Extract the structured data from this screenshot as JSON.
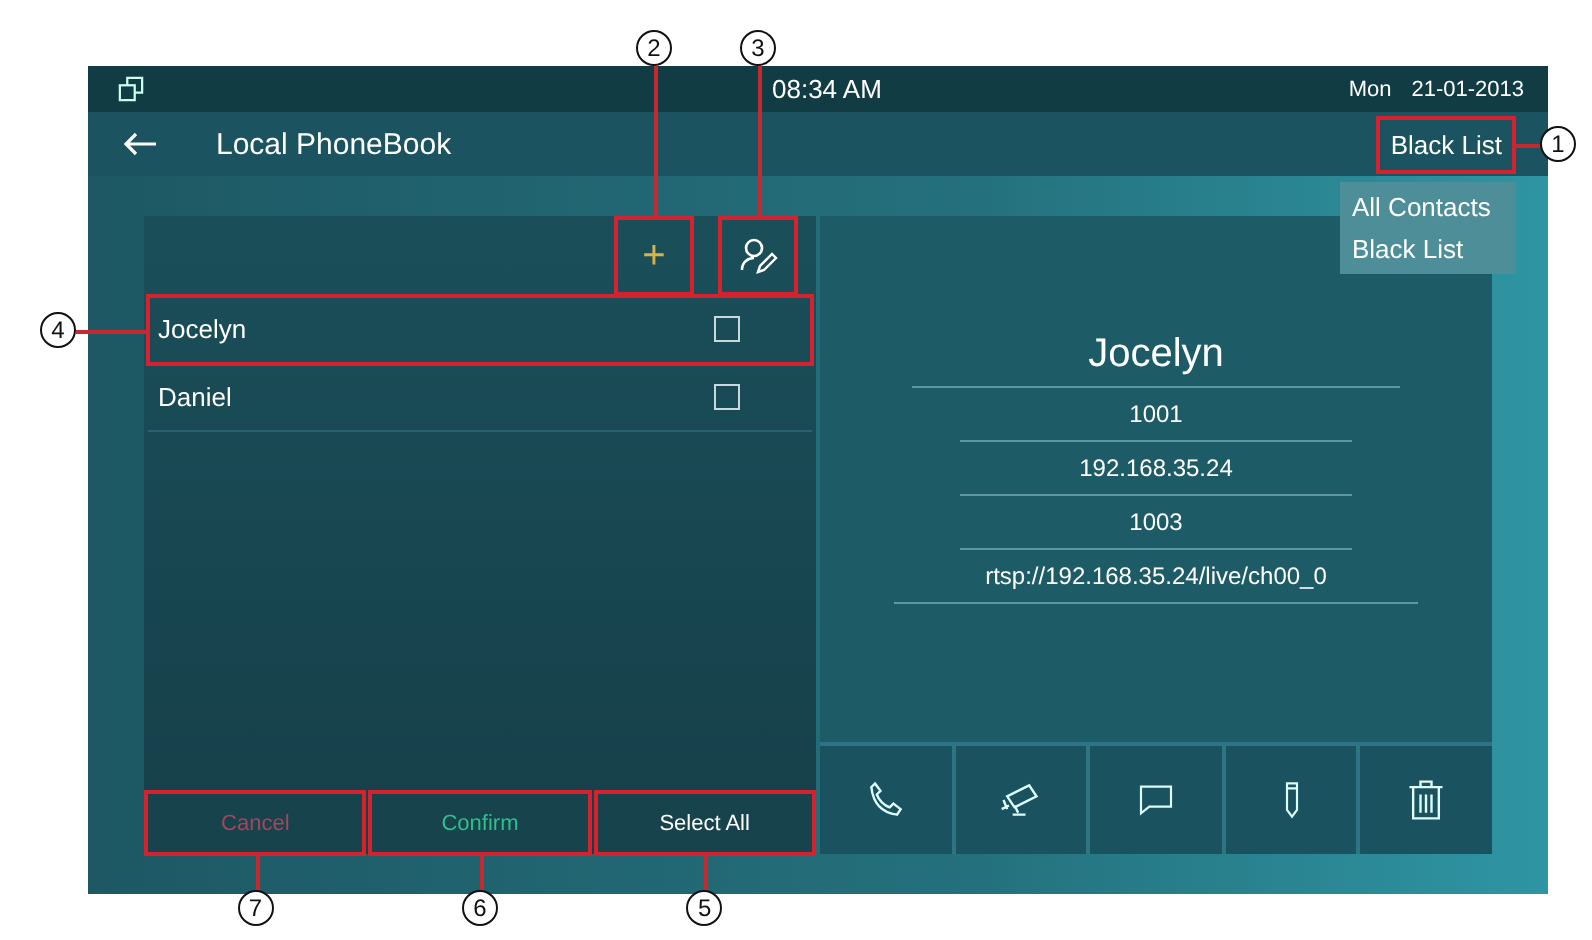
{
  "status_bar": {
    "time": "08:34 AM",
    "day": "Mon",
    "date": "21-01-2013"
  },
  "header": {
    "title": "Local PhoneBook",
    "filter_button": {
      "label": "Black List",
      "callout": "1"
    }
  },
  "filter_menu": {
    "items": [
      {
        "label": "All Contacts"
      },
      {
        "label": "Black List"
      }
    ]
  },
  "toolbar": {
    "add_button": {
      "label": "+",
      "callout": "2"
    },
    "edit_button": {
      "callout": "3"
    }
  },
  "contacts": [
    {
      "name": "Jocelyn",
      "checked": false,
      "callout": "4"
    },
    {
      "name": "Daniel",
      "checked": false
    }
  ],
  "details": {
    "name": "Jocelyn",
    "fields": [
      "1001",
      "192.168.35.24",
      "1003",
      "rtsp://192.168.35.24/live/ch00_0"
    ]
  },
  "actions": [
    {
      "kind": "call"
    },
    {
      "kind": "camera"
    },
    {
      "kind": "message"
    },
    {
      "kind": "edit"
    },
    {
      "kind": "delete"
    }
  ],
  "buttons": [
    {
      "label": "Cancel",
      "kind": "cancel",
      "callout": "7"
    },
    {
      "label": "Confirm",
      "kind": "confirm",
      "callout": "6"
    },
    {
      "label": "Select All",
      "kind": "select_all",
      "callout": "5"
    }
  ]
}
